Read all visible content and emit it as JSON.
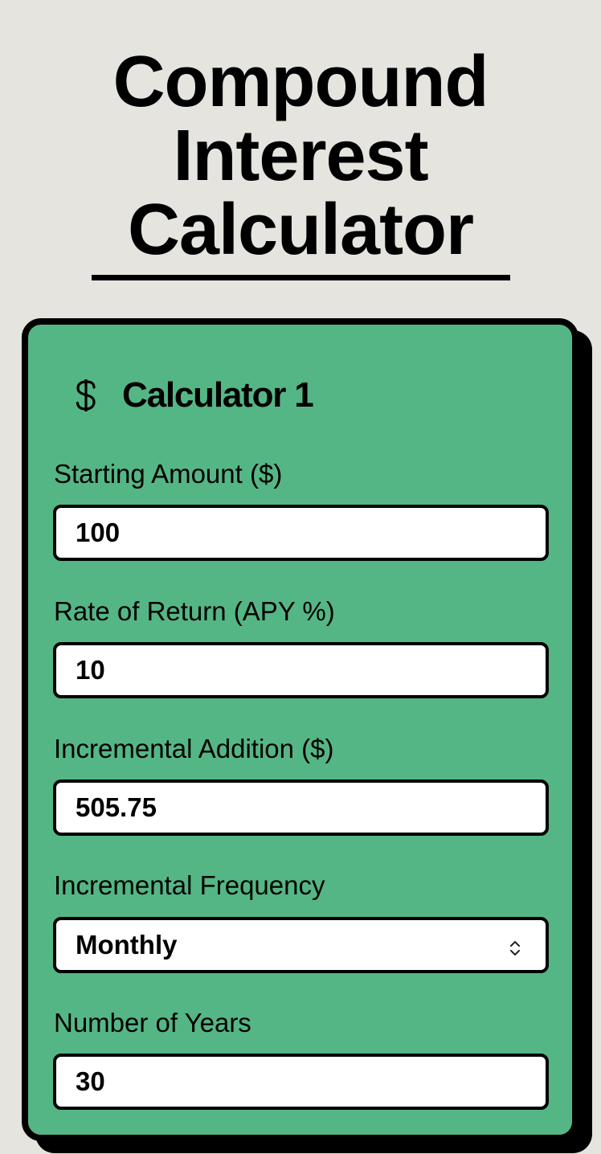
{
  "page": {
    "title": "Compound Interest Calculator"
  },
  "calculator": {
    "icon": "dollar-icon",
    "title": "Calculator 1",
    "fields": [
      {
        "label": "Starting Amount ($)",
        "value": "100"
      },
      {
        "label": "Rate of Return (APY %)",
        "value": "10"
      },
      {
        "label": "Incremental Addition ($)",
        "value": "505.75"
      },
      {
        "label": "Incremental Frequency",
        "value": "Monthly"
      },
      {
        "label": "Number of Years",
        "value": "30"
      }
    ]
  },
  "colors": {
    "background": "#e5e4df",
    "card": "#55b685",
    "border": "#000000",
    "input": "#ffffff"
  }
}
